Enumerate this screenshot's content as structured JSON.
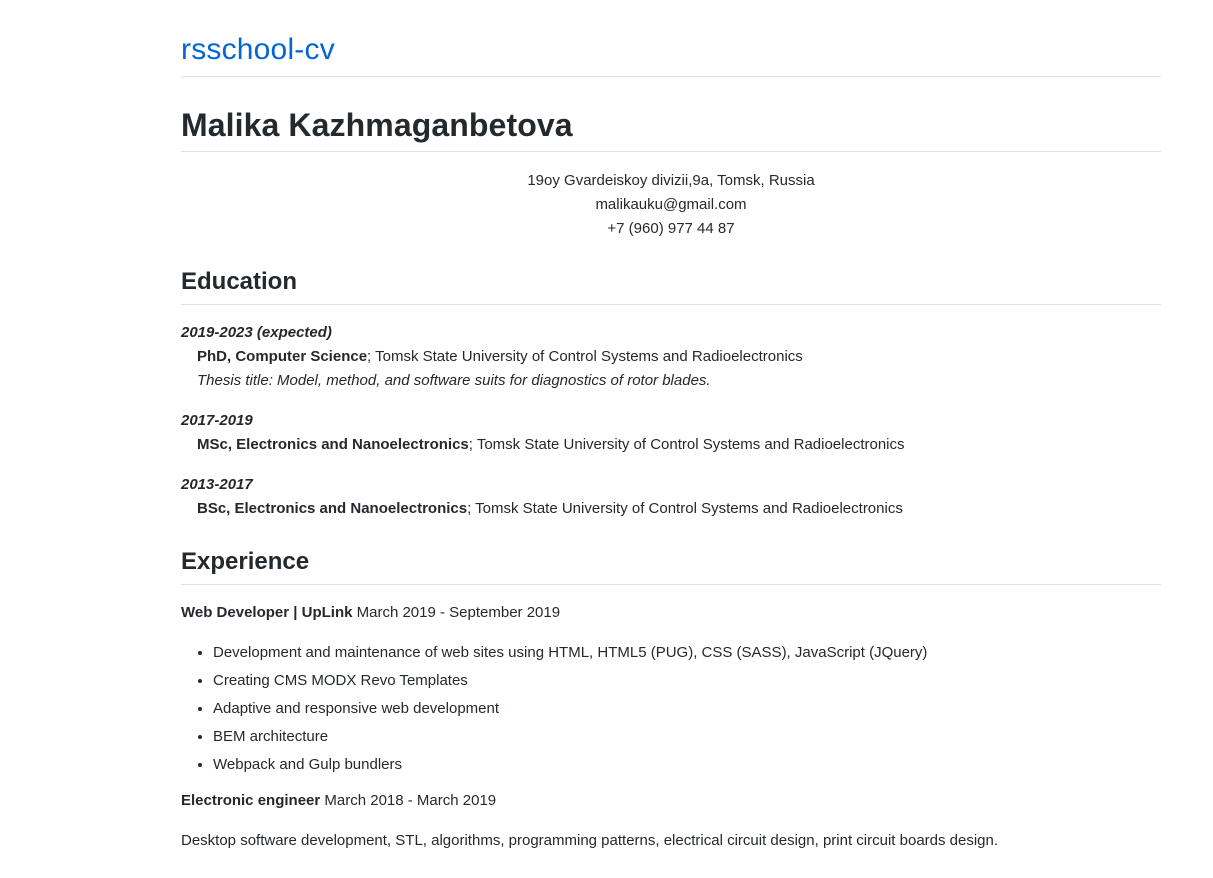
{
  "site": {
    "title": "rsschool-cv"
  },
  "person": {
    "name": "Malika Kazhmaganbetova",
    "address": "19oy Gvardeiskoy divizii,9a, Tomsk, Russia",
    "email": "malikauku@gmail.com",
    "phone": "+7 (960) 977 44 87"
  },
  "education": {
    "heading": "Education",
    "entries": [
      {
        "dates": "2019-2023 (expected)",
        "degree": "PhD, Computer Science",
        "institution": "; Tomsk State University of Control Systems and Radioelectronics",
        "thesis": "Thesis title: Model, method, and software suits for diagnostics of rotor blades."
      },
      {
        "dates": "2017-2019",
        "degree": "MSc, Electronics and Nanoelectronics",
        "institution": "; Tomsk State University of Control Systems and Radioelectronics"
      },
      {
        "dates": "2013-2017",
        "degree": "BSc, Electronics and Nanoelectronics",
        "institution": "; Tomsk State University of Control Systems and Radioelectronics"
      }
    ]
  },
  "experience": {
    "heading": "Experience",
    "jobs": [
      {
        "title": "Web Developer | UpLink",
        "period": " March 2019 - September 2019",
        "duties": [
          "Development and maintenance of web sites using HTML, HTML5 (PUG), CSS (SASS), JavaScript (JQuery)",
          "Creating CMS MODX Revo Templates",
          "Adaptive and responsive web development",
          "BEM architecture",
          "Webpack and Gulp bundlers"
        ]
      },
      {
        "title": "Electronic engineer",
        "period": " March 2018 - March 2019",
        "description": "Desktop software development, STL, algorithms, programming patterns, electrical circuit design, print circuit boards design."
      }
    ]
  }
}
